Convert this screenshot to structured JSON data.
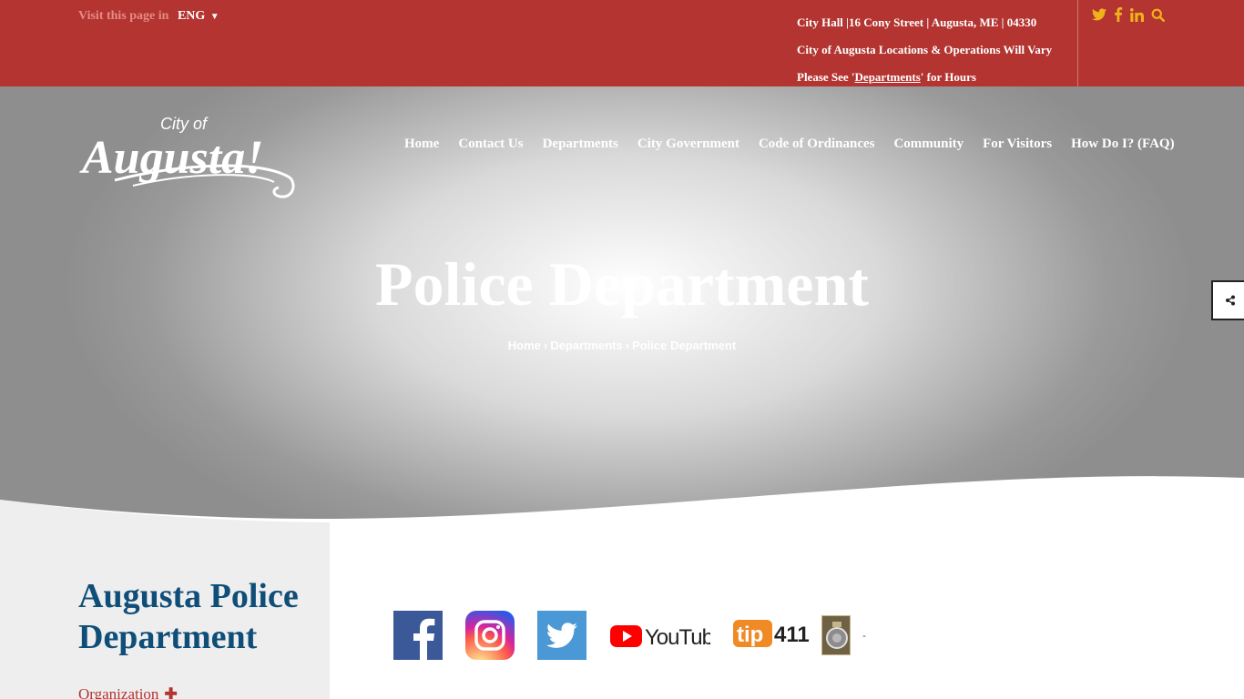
{
  "topbar": {
    "visit_label": "Visit this page in",
    "language": "ENG",
    "address": "City Hall |16 Cony Street | Augusta, ME | 04330",
    "notice": "City of Augusta Locations & Operations Will Vary",
    "hours_prefix": "Please See '",
    "hours_link": "Departments",
    "hours_suffix": "' for Hours",
    "icons": [
      "twitter-icon",
      "facebook-icon",
      "linkedin-icon",
      "search-icon"
    ]
  },
  "logo": {
    "line1": "City of",
    "line2": "Augusta!"
  },
  "nav": {
    "items": [
      "Home",
      "Contact Us",
      "Departments",
      "City Government",
      "Code of Ordinances",
      "Community",
      "For Visitors",
      "How Do I? (FAQ)"
    ]
  },
  "hero": {
    "title": "Police Department",
    "breadcrumb": [
      "Home",
      "Departments",
      "Police Department"
    ],
    "breadcrumb_sep": "›"
  },
  "sidebar": {
    "title": "Augusta Police Department",
    "items": [
      "Organization"
    ]
  },
  "social": {
    "youtube_label": "YouTube",
    "tip_label_a": "tip",
    "tip_label_b": "411",
    "dash": "-"
  },
  "colors": {
    "brand_red": "#b33430",
    "title_blue": "#0f4e78",
    "icon_gold": "#f0b21a"
  }
}
